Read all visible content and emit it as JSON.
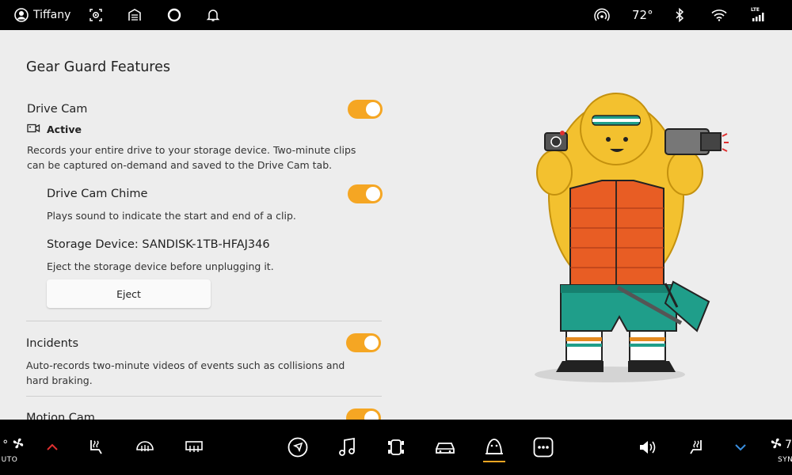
{
  "status_bar": {
    "user_name": "Tiffany",
    "temperature": "72°",
    "network": "LTE",
    "icons": [
      "user-icon",
      "camera-mode-icon",
      "garage-icon",
      "alexa-icon",
      "bell-icon",
      "connectivity-icon",
      "bluetooth-icon",
      "wifi-icon",
      "signal-icon"
    ]
  },
  "page": {
    "title": "Gear Guard Features"
  },
  "drive_cam": {
    "label": "Drive Cam",
    "status": "Active",
    "description_line1": "Records your entire drive to your storage device. Two-minute clips",
    "description_line2": "can be captured on-demand and saved to the Drive Cam tab.",
    "enabled": true
  },
  "drive_cam_chime": {
    "label": "Drive Cam Chime",
    "description": "Plays sound to indicate the start and end of a clip.",
    "enabled": true
  },
  "storage": {
    "label": "Storage Device: SANDISK-1TB-HFAJ346",
    "description": "Eject the storage device before unplugging it.",
    "eject_label": "Eject"
  },
  "incidents": {
    "label": "Incidents",
    "description_line1": "Auto-records two-minute videos of events such as collisions and",
    "description_line2": "hard braking.",
    "enabled": true
  },
  "motion_cam": {
    "label": "Motion Cam",
    "enabled": true
  },
  "bottom_bar": {
    "left_temp_fragment": "°",
    "left_auto_fragment": "UTO",
    "right_temp_fragment": "7",
    "right_sync_fragment": "SYN",
    "active_tab": "gear-guard",
    "accent_color": "#f5a623",
    "up_chevron_color": "#e03030",
    "down_chevron_color": "#3a8fe0"
  },
  "colors": {
    "toggle_on": "#f5a623",
    "background": "#ededed",
    "bar": "#000000"
  }
}
